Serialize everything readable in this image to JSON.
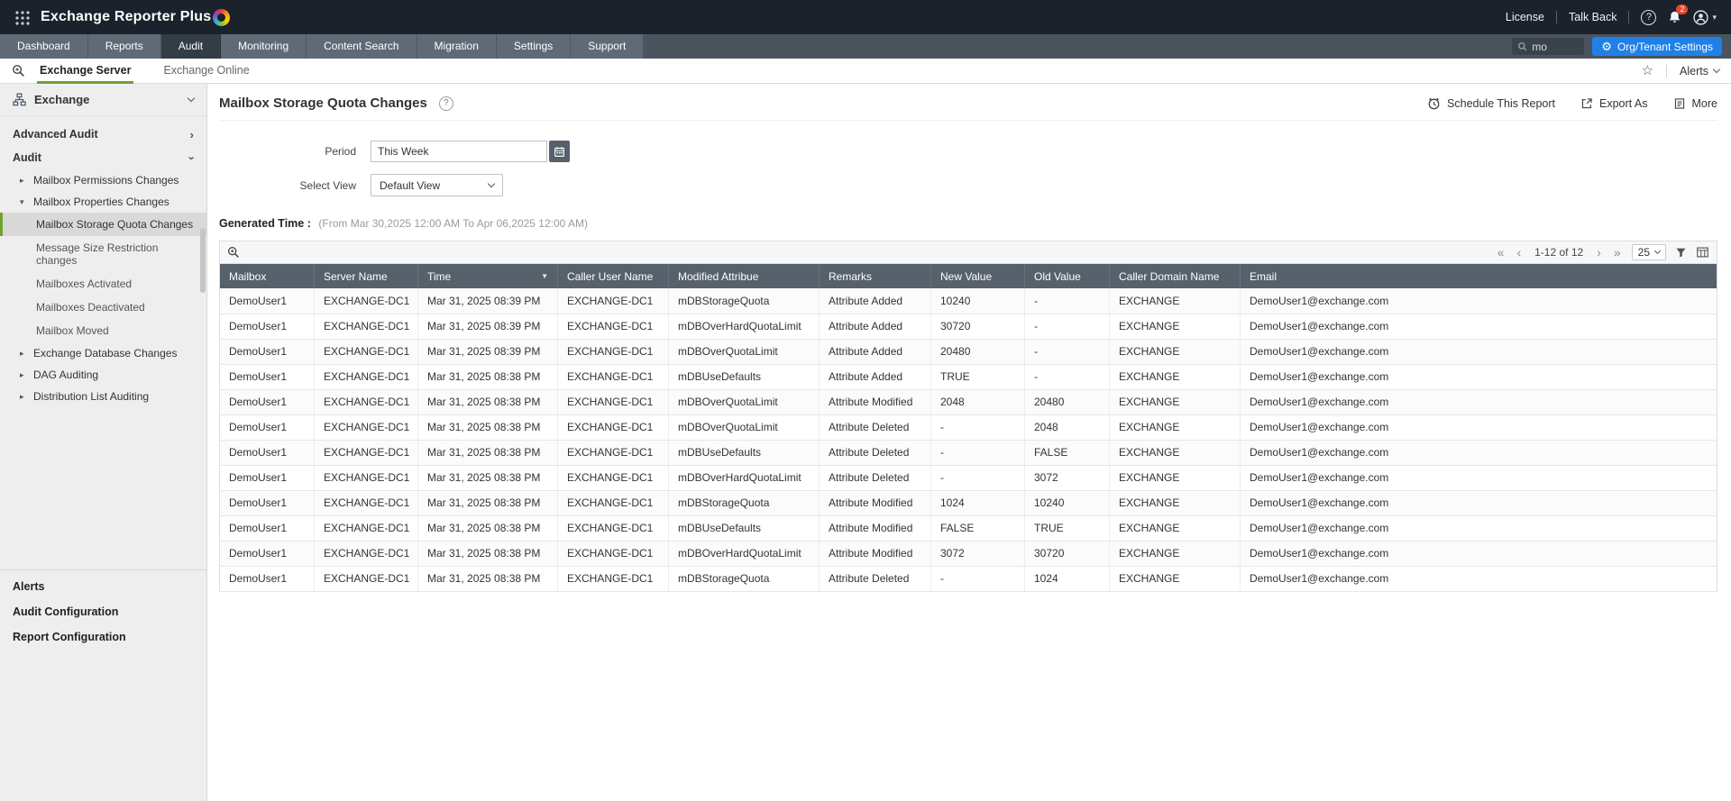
{
  "icons": {
    "pager_first": "«",
    "pager_prev": "‹",
    "pager_next": "›",
    "pager_last": "»",
    "sort_desc": "▼",
    "caret_down": "▾",
    "star": "☆",
    "gear": "⚙",
    "help": "?",
    "tree_collapsed": "▸",
    "tree_expanded": "▾",
    "chevron": "›"
  },
  "colors": {
    "accent_green": "#6fa22e",
    "accent_blue": "#2080e8",
    "table_header": "#57616c",
    "topbar": "#1c222b",
    "badge_red": "#e8472e"
  },
  "header": {
    "app_title": "Exchange Reporter Plus",
    "license_label": "License",
    "talkback_label": "Talk Back",
    "notification_count": "2"
  },
  "nav": {
    "tabs": [
      {
        "label": "Dashboard",
        "active": false
      },
      {
        "label": "Reports",
        "active": false
      },
      {
        "label": "Audit",
        "active": true
      },
      {
        "label": "Monitoring",
        "active": false
      },
      {
        "label": "Content Search",
        "active": false
      },
      {
        "label": "Migration",
        "active": false
      },
      {
        "label": "Settings",
        "active": false
      },
      {
        "label": "Support",
        "active": false
      }
    ],
    "search_value": "mo",
    "org_settings_label": "Org/Tenant Settings"
  },
  "subnav": {
    "tabs": [
      {
        "label": "Exchange Server",
        "active": true
      },
      {
        "label": "Exchange Online",
        "active": false
      }
    ],
    "alerts_label": "Alerts"
  },
  "sidebar": {
    "section_title": "Exchange",
    "tree": [
      {
        "label": "Advanced Audit",
        "level": 0,
        "arrow": "right"
      },
      {
        "label": "Audit",
        "level": 0,
        "arrow": "down"
      },
      {
        "label": "Mailbox Permissions Changes",
        "level": 1,
        "arrow": "collapsed"
      },
      {
        "label": "Mailbox Properties Changes",
        "level": 1,
        "arrow": "expanded"
      },
      {
        "label": "Mailbox Storage Quota Changes",
        "level": 2,
        "selected": true
      },
      {
        "label": "Message Size Restriction changes",
        "level": 2
      },
      {
        "label": "Mailboxes Activated",
        "level": 2
      },
      {
        "label": "Mailboxes Deactivated",
        "level": 2
      },
      {
        "label": "Mailbox Moved",
        "level": 2
      },
      {
        "label": "Exchange Database Changes",
        "level": 1,
        "arrow": "collapsed"
      },
      {
        "label": "DAG Auditing",
        "level": 1,
        "arrow": "collapsed"
      },
      {
        "label": "Distribution List Auditing",
        "level": 1,
        "arrow": "collapsed"
      }
    ],
    "footer_items": [
      "Alerts",
      "Audit Configuration",
      "Report Configuration"
    ]
  },
  "main": {
    "title": "Mailbox Storage Quota Changes",
    "actions": [
      {
        "label": "Schedule This Report"
      },
      {
        "label": "Export As"
      },
      {
        "label": "More"
      }
    ],
    "form": {
      "period_label": "Period",
      "period_value": "This Week",
      "view_label": "Select View",
      "view_value": "Default View"
    },
    "generated_label": "Generated Time :",
    "generated_value": "(From Mar 30,2025 12:00 AM To Apr 06,2025 12:00 AM)",
    "pagination": {
      "range": "1-12 of 12",
      "page_size": "25"
    },
    "table": {
      "sorted_column": "Time",
      "columns": [
        "Mailbox",
        "Server Name",
        "Time",
        "Caller User Name",
        "Modified Attribue",
        "Remarks",
        "New Value",
        "Old Value",
        "Caller Domain Name",
        "Email"
      ],
      "rows": [
        [
          "DemoUser1",
          "EXCHANGE-DC1",
          "Mar 31, 2025 08:39 PM",
          "EXCHANGE-DC1",
          "mDBStorageQuota",
          "Attribute Added",
          "10240",
          "-",
          "EXCHANGE",
          "DemoUser1@exchange.com"
        ],
        [
          "DemoUser1",
          "EXCHANGE-DC1",
          "Mar 31, 2025 08:39 PM",
          "EXCHANGE-DC1",
          "mDBOverHardQuotaLimit",
          "Attribute Added",
          "30720",
          "-",
          "EXCHANGE",
          "DemoUser1@exchange.com"
        ],
        [
          "DemoUser1",
          "EXCHANGE-DC1",
          "Mar 31, 2025 08:39 PM",
          "EXCHANGE-DC1",
          "mDBOverQuotaLimit",
          "Attribute Added",
          "20480",
          "-",
          "EXCHANGE",
          "DemoUser1@exchange.com"
        ],
        [
          "DemoUser1",
          "EXCHANGE-DC1",
          "Mar 31, 2025 08:38 PM",
          "EXCHANGE-DC1",
          "mDBUseDefaults",
          "Attribute Added",
          "TRUE",
          "-",
          "EXCHANGE",
          "DemoUser1@exchange.com"
        ],
        [
          "DemoUser1",
          "EXCHANGE-DC1",
          "Mar 31, 2025 08:38 PM",
          "EXCHANGE-DC1",
          "mDBOverQuotaLimit",
          "Attribute Modified",
          "2048",
          "20480",
          "EXCHANGE",
          "DemoUser1@exchange.com"
        ],
        [
          "DemoUser1",
          "EXCHANGE-DC1",
          "Mar 31, 2025 08:38 PM",
          "EXCHANGE-DC1",
          "mDBOverQuotaLimit",
          "Attribute Deleted",
          "-",
          "2048",
          "EXCHANGE",
          "DemoUser1@exchange.com"
        ],
        [
          "DemoUser1",
          "EXCHANGE-DC1",
          "Mar 31, 2025 08:38 PM",
          "EXCHANGE-DC1",
          "mDBUseDefaults",
          "Attribute Deleted",
          "-",
          "FALSE",
          "EXCHANGE",
          "DemoUser1@exchange.com"
        ],
        [
          "DemoUser1",
          "EXCHANGE-DC1",
          "Mar 31, 2025 08:38 PM",
          "EXCHANGE-DC1",
          "mDBOverHardQuotaLimit",
          "Attribute Deleted",
          "-",
          "3072",
          "EXCHANGE",
          "DemoUser1@exchange.com"
        ],
        [
          "DemoUser1",
          "EXCHANGE-DC1",
          "Mar 31, 2025 08:38 PM",
          "EXCHANGE-DC1",
          "mDBStorageQuota",
          "Attribute Modified",
          "1024",
          "10240",
          "EXCHANGE",
          "DemoUser1@exchange.com"
        ],
        [
          "DemoUser1",
          "EXCHANGE-DC1",
          "Mar 31, 2025 08:38 PM",
          "EXCHANGE-DC1",
          "mDBUseDefaults",
          "Attribute Modified",
          "FALSE",
          "TRUE",
          "EXCHANGE",
          "DemoUser1@exchange.com"
        ],
        [
          "DemoUser1",
          "EXCHANGE-DC1",
          "Mar 31, 2025 08:38 PM",
          "EXCHANGE-DC1",
          "mDBOverHardQuotaLimit",
          "Attribute Modified",
          "3072",
          "30720",
          "EXCHANGE",
          "DemoUser1@exchange.com"
        ],
        [
          "DemoUser1",
          "EXCHANGE-DC1",
          "Mar 31, 2025 08:38 PM",
          "EXCHANGE-DC1",
          "mDBStorageQuota",
          "Attribute Deleted",
          "-",
          "1024",
          "EXCHANGE",
          "DemoUser1@exchange.com"
        ]
      ]
    }
  }
}
